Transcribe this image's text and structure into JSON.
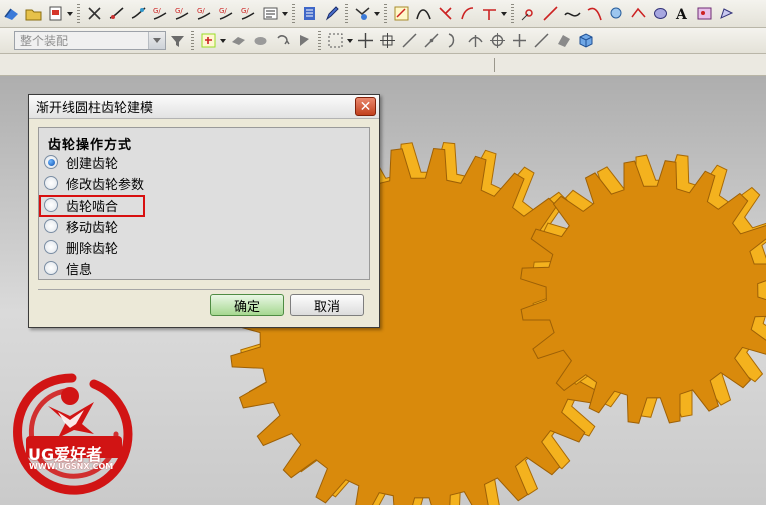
{
  "toolbar": {
    "assembly_combo": "整个装配"
  },
  "dialog": {
    "title": "渐开线圆柱齿轮建模",
    "group_title": "齿轮操作方式",
    "options": [
      {
        "label": "创建齿轮",
        "selected": true
      },
      {
        "label": "修改齿轮参数",
        "selected": false
      },
      {
        "label": "齿轮啮合",
        "selected": false
      },
      {
        "label": "移动齿轮",
        "selected": false
      },
      {
        "label": "删除齿轮",
        "selected": false
      },
      {
        "label": "信息",
        "selected": false
      }
    ],
    "highlighted_option": "齿轮啮合",
    "ok_label": "确定",
    "cancel_label": "取消"
  },
  "watermark": {
    "brand": "UG爱好者",
    "url": "WWW.UGSNX.COM"
  },
  "colors": {
    "gear_face": "#d98a0c",
    "gear_tooth_side": "#f4b21e",
    "highlight": "#d80f0f",
    "logo_red": "#d11414"
  }
}
